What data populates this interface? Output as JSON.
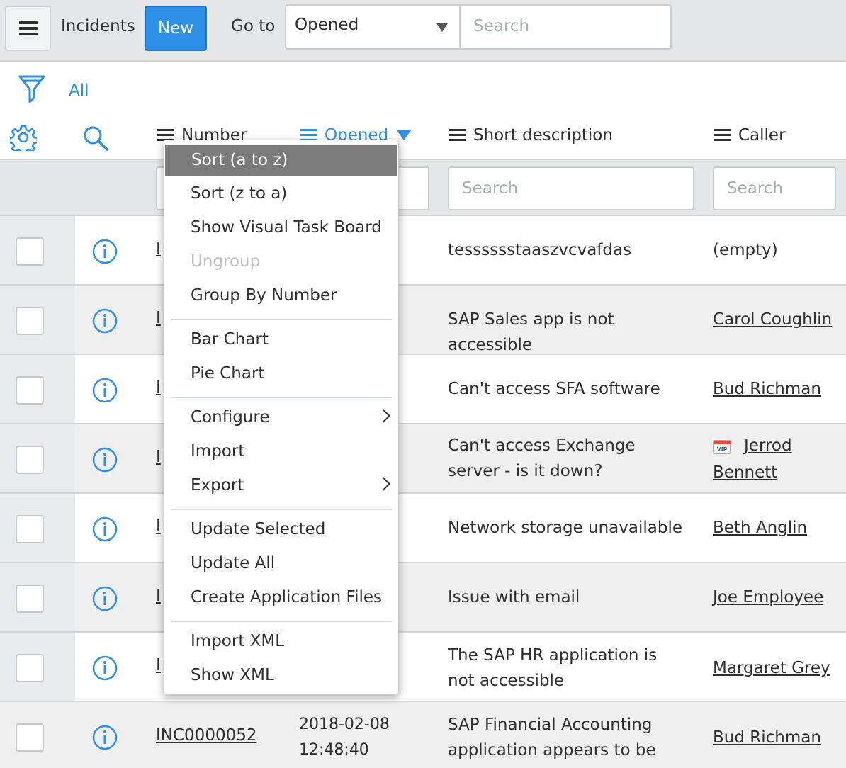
{
  "header": {
    "title": "Incidents",
    "new_label": "New",
    "goto_label": "Go to",
    "goto_selected": "Opened",
    "search_placeholder": "Search"
  },
  "filter": {
    "all_label": "All"
  },
  "columns": {
    "number": "Number",
    "opened": "Opened",
    "short_description": "Short description",
    "caller": "Caller",
    "search_placeholder": "Search"
  },
  "rows": [
    {
      "number": "",
      "opened": "",
      "desc": "tesssssstaaszvcvafdas",
      "caller": "(empty)",
      "caller_link": false
    },
    {
      "number": "",
      "opened": "",
      "desc": "SAP Sales app is not accessible",
      "caller": "Carol Coughlin",
      "caller_link": true
    },
    {
      "number": "",
      "opened": "",
      "desc": "Can't access SFA software",
      "caller": "Bud Richman",
      "caller_link": true
    },
    {
      "number": "",
      "opened": "",
      "desc": "Can't access Exchange server - is it down?",
      "caller": "Jerrod Bennett",
      "caller_link": true,
      "vip": true
    },
    {
      "number": "",
      "opened": "",
      "desc": "Network storage unavailable",
      "caller": "Beth Anglin",
      "caller_link": true
    },
    {
      "number": "",
      "opened": "",
      "desc": "Issue with email",
      "caller": "Joe Employee",
      "caller_link": true
    },
    {
      "number": "",
      "opened": "",
      "desc": "The SAP HR application is not accessible",
      "caller": "Margaret Grey",
      "caller_link": true
    },
    {
      "number": "INC0000052",
      "opened_date": "2018-02-08",
      "opened_time": "12:48:40",
      "desc": "SAP Financial Accounting application appears to be down",
      "caller": "Bud Richman",
      "caller_link": true
    }
  ],
  "partial_number_prefix": "I",
  "context_menu": {
    "sort_asc": "Sort (a to z)",
    "sort_desc": "Sort (z to a)",
    "visual_task_board": "Show Visual Task Board",
    "ungroup": "Ungroup",
    "group_by": "Group By Number",
    "bar_chart": "Bar Chart",
    "pie_chart": "Pie Chart",
    "configure": "Configure",
    "import": "Import",
    "export": "Export",
    "update_selected": "Update Selected",
    "update_all": "Update All",
    "create_app_files": "Create Application Files",
    "import_xml": "Import XML",
    "show_xml": "Show XML"
  },
  "colors": {
    "accent": "#2e8fe6",
    "menu_highlight": "#7b7b7b"
  }
}
